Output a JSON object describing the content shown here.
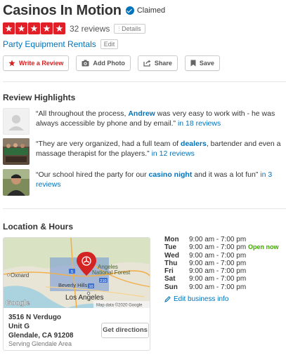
{
  "business": {
    "name": "Casinos In Motion",
    "claimed_label": "Claimed",
    "rating_stars": 5,
    "review_count": "32 reviews",
    "details_label": "Details",
    "category": "Party Equipment Rentals",
    "edit_label": "Edit"
  },
  "actions": {
    "write_review": "Write a Review",
    "add_photo": "Add Photo",
    "share": "Share",
    "save": "Save"
  },
  "highlights": {
    "title": "Review Highlights",
    "items": [
      {
        "pre": "“All throughout the process, ",
        "keyword": "Andrew",
        "post": " was very easy to work with - he was always accessible by phone and by email.” ",
        "more": "in 18 reviews"
      },
      {
        "pre": "“They are very organized, had a full team of ",
        "keyword": "dealers",
        "post": ", bartender and even a massage therapist for the players.” ",
        "more": "in 12 reviews"
      },
      {
        "pre": "“Our school hired the party for our ",
        "keyword": "casino night",
        "post": " and it was a lot fun” ",
        "more": "in 3 reviews"
      }
    ]
  },
  "location": {
    "title": "Location & Hours",
    "map_labels": {
      "oxnard": "Oxnard",
      "angeles_forest": "Angeles\nNational Forest",
      "beverly_hills": "Beverly Hills",
      "los_angeles": "Los Angeles",
      "google": "Google",
      "map_data": "Map data ©2020 Google",
      "hwy5": "5",
      "hwy210": "210",
      "hwy10": "10"
    },
    "address_line1": "3516 N Verdugo",
    "address_line2": "Unit G",
    "address_line3": "Glendale, CA 91208",
    "serving": "Serving Glendale Area",
    "directions_label": "Get directions"
  },
  "hours": {
    "rows": [
      {
        "day": "Mon",
        "time": "9:00 am - 7:00 pm",
        "status": ""
      },
      {
        "day": "Tue",
        "time": "9:00 am - 7:00 pm",
        "status": "Open now"
      },
      {
        "day": "Wed",
        "time": "9:00 am - 7:00 pm",
        "status": ""
      },
      {
        "day": "Thu",
        "time": "9:00 am - 7:00 pm",
        "status": ""
      },
      {
        "day": "Fri",
        "time": "9:00 am - 7:00 pm",
        "status": ""
      },
      {
        "day": "Sat",
        "time": "9:00 am - 7:00 pm",
        "status": ""
      },
      {
        "day": "Sun",
        "time": "9:00 am - 7:00 pm",
        "status": ""
      }
    ],
    "edit_label": "Edit business info"
  },
  "colors": {
    "brand_red": "#d32323",
    "star_red": "#e01f26",
    "link_blue": "#0073bb",
    "open_green": "#41a700"
  },
  "icons": {
    "claimed": "check-circle-icon",
    "star": "star-icon",
    "details": "bar-chart-icon",
    "write_review": "star-icon",
    "add_photo": "camera-icon",
    "share": "share-icon",
    "save": "bookmark-icon",
    "map_pin": "yelp-map-pin-icon",
    "edit_info": "pencil-icon"
  }
}
